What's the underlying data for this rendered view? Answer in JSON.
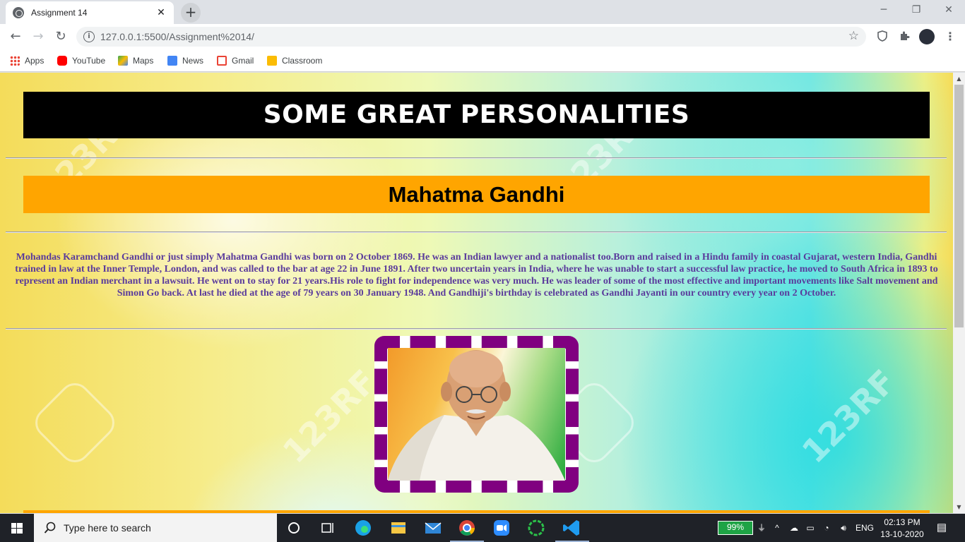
{
  "browser": {
    "tab_title": "Assignment 14",
    "tab_close": "✕",
    "new_tab": "+",
    "url": "127.0.0.1:5500/Assignment%2014/",
    "window_controls": {
      "minimize": "─",
      "restore": "❐",
      "close": "✕"
    },
    "nav": {
      "back": "←",
      "forward": "→",
      "reload": "↻"
    },
    "bookmarks": [
      {
        "label": "Apps",
        "color": "#4285f4"
      },
      {
        "label": "YouTube",
        "color": "#ff0000"
      },
      {
        "label": "Maps",
        "color": "#34a853"
      },
      {
        "label": "News",
        "color": "#4285f4"
      },
      {
        "label": "Gmail",
        "color": "#ea4335"
      },
      {
        "label": "Classroom",
        "color": "#fbbc04"
      }
    ]
  },
  "page": {
    "heading": "SOME GREAT PERSONALITIES",
    "personality_name": "Mahatma Gandhi",
    "bio": "Mohandas Karamchand Gandhi or just simply Mahatma Gandhi was born on 2 October 1869. He was an Indian lawyer and a nationalist too.Born and raised in a Hindu family in coastal Gujarat, western India, Gandhi trained in law at the Inner Temple, London, and was called to the bar at age 22 in June 1891. After two uncertain years in India, where he was unable to start a successful law practice, he moved to South Africa in 1893 to represent an Indian merchant in a lawsuit. He went on to stay for 21 years.His role to fight for independence was very much. He was leader of some of the most effective and important movements like Salt movement and Simon Go back. At last he died at the age of 79 years on 30 January 1948. And Gandhiji's birthday is celebrated as Gandhi Jayanti in our country every year on 2 October.",
    "watermark": "123RF",
    "colors": {
      "header_bg": "#000000",
      "name_bg": "#ffa500",
      "frame": "#800080",
      "bio_text": "#5a3b9c"
    }
  },
  "taskbar": {
    "search_placeholder": "Type here to search",
    "battery": "99%",
    "language": "ENG",
    "time": "02:13 PM",
    "date": "13-10-2020"
  }
}
